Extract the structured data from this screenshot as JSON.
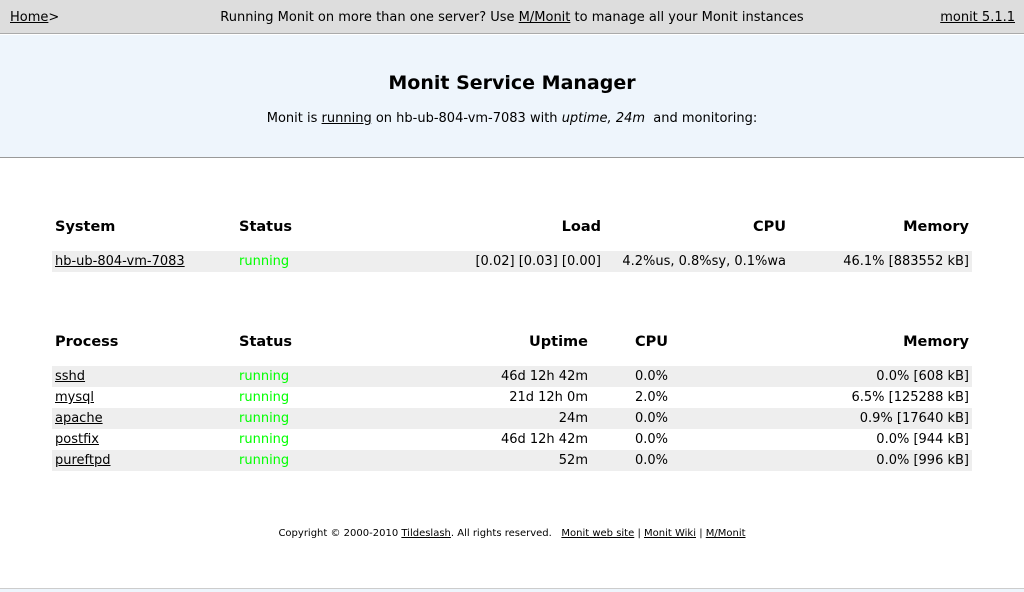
{
  "topbar": {
    "home_label": "Home",
    "home_suffix": ">",
    "promo_prefix": "Running Monit on more than one server? Use ",
    "promo_link": "M/Monit",
    "promo_suffix": " to manage all your Monit instances",
    "version_link": "monit 5.1.1"
  },
  "hero": {
    "title": "Monit Service Manager",
    "status_prefix": "Monit is ",
    "status_link": "running",
    "status_mid": " on hb-ub-804-vm-7083 with ",
    "uptime_text": "uptime, 24m",
    "status_suffix": "  and monitoring:"
  },
  "system_table": {
    "headers": {
      "system": "System",
      "status": "Status",
      "load": "Load",
      "cpu": "CPU",
      "memory": "Memory"
    },
    "rows": [
      {
        "name": "hb-ub-804-vm-7083",
        "status": "running",
        "load": "[0.02] [0.03] [0.00]",
        "cpu": "4.2%us, 0.8%sy, 0.1%wa",
        "memory": "46.1% [883552 kB]"
      }
    ]
  },
  "process_table": {
    "headers": {
      "process": "Process",
      "status": "Status",
      "uptime": "Uptime",
      "cpu": "CPU",
      "memory": "Memory"
    },
    "rows": [
      {
        "name": "sshd",
        "status": "running",
        "uptime": "46d 12h 42m",
        "cpu": "0.0%",
        "memory": "0.0% [608 kB]"
      },
      {
        "name": "mysql",
        "status": "running",
        "uptime": "21d 12h 0m",
        "cpu": "2.0%",
        "memory": "6.5% [125288 kB]"
      },
      {
        "name": "apache",
        "status": "running",
        "uptime": "24m",
        "cpu": "0.0%",
        "memory": "0.9% [17640 kB]"
      },
      {
        "name": "postfix",
        "status": "running",
        "uptime": "46d 12h 42m",
        "cpu": "0.0%",
        "memory": "0.0% [944 kB]"
      },
      {
        "name": "pureftpd",
        "status": "running",
        "uptime": "52m",
        "cpu": "0.0%",
        "memory": "0.0% [996 kB]"
      }
    ]
  },
  "footer": {
    "copyright_prefix": "Copyright © 2000-2010 ",
    "company_link": "Tildeslash",
    "copyright_suffix": ". All rights reserved.",
    "links": [
      "Monit web site",
      "Monit Wiki",
      "M/Monit"
    ],
    "separator": "|"
  },
  "colors": {
    "running": "#00ff00",
    "hero_bg": "#eef5fc",
    "topbar_bg": "#dddddd",
    "row_shade": "#eeeeee"
  }
}
